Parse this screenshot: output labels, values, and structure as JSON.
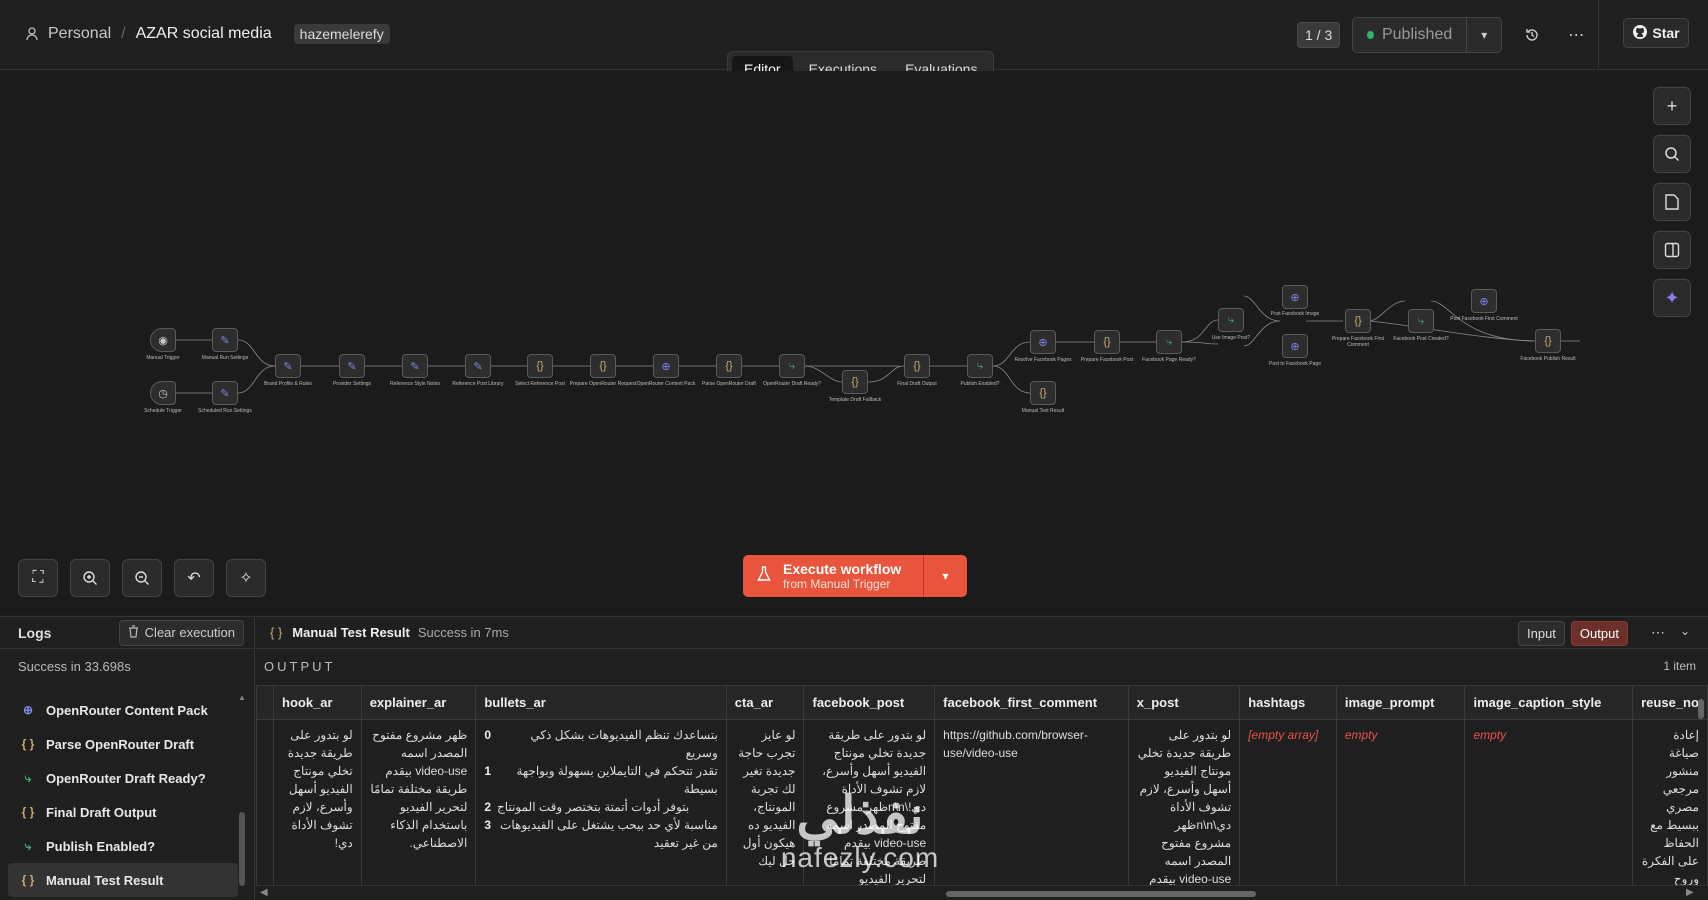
{
  "header": {
    "breadcrumb_personal": "Personal",
    "breadcrumb_sep": "/",
    "workflow_name": "AZAR social media",
    "tag": "hazemelerefy",
    "version_counter": "1 / 3",
    "published_label": "Published",
    "star_label": "Star"
  },
  "tabs": [
    "Editor",
    "Executions",
    "Evaluations"
  ],
  "canvas": {
    "nodes": [
      {
        "label": "Manual Trigger",
        "icon": "trigger-icon",
        "kind": "trigger"
      },
      {
        "label": "Schedule Trigger",
        "icon": "clock-icon",
        "kind": "trigger"
      },
      {
        "label": "Manual Run Settings",
        "icon": "edit-icon",
        "kind": "set"
      },
      {
        "label": "Scheduled Run Settings",
        "icon": "edit-icon",
        "kind": "set"
      },
      {
        "label": "Brand Profile & Rules",
        "icon": "edit-icon",
        "kind": "set"
      },
      {
        "label": "Provider Settings",
        "icon": "edit-icon",
        "kind": "set"
      },
      {
        "label": "Reference Style Notes",
        "icon": "edit-icon",
        "kind": "set"
      },
      {
        "label": "Reference Post Library",
        "icon": "edit-icon",
        "kind": "set"
      },
      {
        "label": "Select Reference Post",
        "icon": "code-icon",
        "kind": "code"
      },
      {
        "label": "Prepare OpenRouter Request",
        "icon": "code-icon",
        "kind": "code"
      },
      {
        "label": "OpenRouter Content Pack",
        "icon": "globe-icon",
        "kind": "http"
      },
      {
        "label": "Parse OpenRouter Draft",
        "icon": "code-icon",
        "kind": "code"
      },
      {
        "label": "OpenRouter Draft Ready?",
        "icon": "switch-icon",
        "kind": "if"
      },
      {
        "label": "Template Draft Fallback",
        "icon": "code-icon",
        "kind": "code"
      },
      {
        "label": "Final Draft Output",
        "icon": "code-icon",
        "kind": "code"
      },
      {
        "label": "Publish Enabled?",
        "icon": "switch-icon",
        "kind": "if"
      },
      {
        "label": "Resolve Facebook Pages",
        "icon": "globe-icon",
        "kind": "http"
      },
      {
        "label": "Manual Test Result",
        "icon": "code-icon",
        "kind": "code"
      },
      {
        "label": "Prepare Facebook Post",
        "icon": "code-icon",
        "kind": "code"
      },
      {
        "label": "Facebook Page Ready?",
        "icon": "switch-icon",
        "kind": "if"
      },
      {
        "label": "Use Image Post?",
        "icon": "switch-icon",
        "kind": "if"
      },
      {
        "label": "Post Facebook Image",
        "icon": "globe-icon",
        "kind": "http"
      },
      {
        "label": "Post to Facebook Page",
        "icon": "globe-icon",
        "kind": "http"
      },
      {
        "label": "Prepare Facebook First Comment",
        "icon": "code-icon",
        "kind": "code"
      },
      {
        "label": "Facebook Post Created?",
        "icon": "switch-icon",
        "kind": "if"
      },
      {
        "label": "Post Facebook First Comment",
        "icon": "globe-icon",
        "kind": "http"
      },
      {
        "label": "Facebook Publish Result",
        "icon": "code-icon",
        "kind": "code"
      }
    ]
  },
  "execute": {
    "title": "Execute workflow",
    "subtitle": "from Manual Trigger"
  },
  "logs": {
    "title": "Logs",
    "clear_label": "Clear execution",
    "status": "Success in 33.698s",
    "items": [
      {
        "label": "OpenRouter Content Pack",
        "icon": "globe-icon",
        "kind": "g"
      },
      {
        "label": "Parse OpenRouter Draft",
        "icon": "code-icon",
        "kind": "c"
      },
      {
        "label": "OpenRouter Draft Ready?",
        "icon": "switch-icon",
        "kind": "s"
      },
      {
        "label": "Final Draft Output",
        "icon": "code-icon",
        "kind": "c"
      },
      {
        "label": "Publish Enabled?",
        "icon": "switch-icon",
        "kind": "s"
      },
      {
        "label": "Manual Test Result",
        "icon": "code-icon",
        "kind": "c",
        "selected": true
      }
    ]
  },
  "output": {
    "node_name": "Manual Test Result",
    "status": "Success in 7ms",
    "input_label": "Input",
    "output_label": "Output",
    "section_label": "OUTPUT",
    "item_count": "1 item",
    "columns": [
      "hook_ar",
      "explainer_ar",
      "bullets_ar",
      "cta_ar",
      "facebook_post",
      "facebook_first_comment",
      "x_post",
      "hashtags",
      "image_prompt",
      "image_caption_style",
      "reuse_no"
    ],
    "row": {
      "hook_ar": "لو بتدور على طريقة جديدة تخلي مونتاج الفيديو أسهل وأسرع، لازم تشوف الأداة دي!",
      "explainer_ar": "ظهر مشروع مفتوح المصدر اسمه video-use بيقدم طريقة مختلفة تمامًا لتحرير الفيديو باستخدام الذكاء الاصطناعي.",
      "bullets_ar": [
        {
          "k": "0",
          "v": "بتساعدك تنظم الفيديوهات بشكل ذكي وسريع"
        },
        {
          "k": "1",
          "v": "تقدر تتحكم في التايملاين بسهولة وبواجهة بسيطة"
        },
        {
          "k": "2",
          "v": "بتوفر أدوات أتمتة بتختصر وقت المونتاج"
        },
        {
          "k": "3",
          "v": "مناسبة لأي حد بيحب يشتغل على الفيديوهات من غير تعقيد"
        }
      ],
      "cta_ar": "لو عايز تجرب حاجة جديدة تغير لك تجربة المونتاج، الفيديو ده هيكون أول حل ليك",
      "facebook_post": "لو بتدور على طريقة جديدة تخلي مونتاج الفيديو أسهل وأسرع، لازم تشوف الأداة دي!\\n\\nظهر مشروع مفتوح المصدر اسمه video-use بيقدم طريقة مختلفة تمامًا لتحرير الفيديو باستخدام الذكاء",
      "facebook_first_comment": "https://github.com/browser-use/video-use",
      "x_post": "لو بتدور على طريقة جديدة تخلي مونتاج الفيديو أسهل وأسرع، لازم تشوف الأداة دي\\n\\nظهر مشروع مفتوح المصدر اسمه video-use بيقدم",
      "hashtags": "[empty array]",
      "image_prompt": "empty",
      "image_caption_style": "empty",
      "reuse_no": "إعادة صياغة منشور مرجعي مصري ببسيط مع الحفاظ على الفكرة وروح الصفحة"
    }
  },
  "watermark": {
    "line1": "نفذلي",
    "line2": "nafezly.com"
  },
  "colors": {
    "accent": "#e8553c",
    "success_dot": "#2fb36d",
    "empty_text": "#e5534b"
  }
}
